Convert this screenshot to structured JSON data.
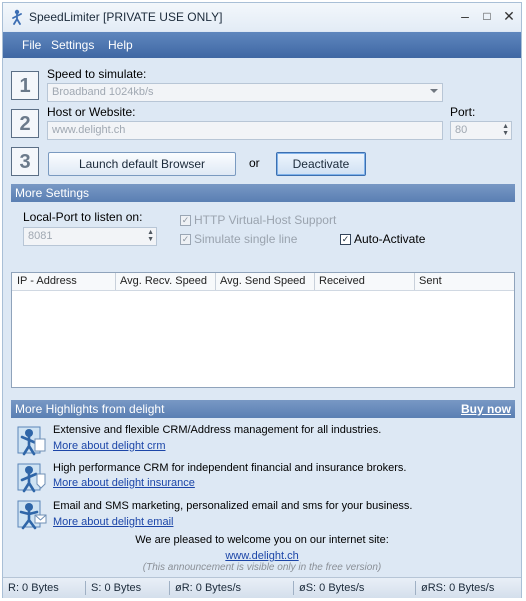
{
  "window": {
    "title": "SpeedLimiter [PRIVATE USE ONLY]",
    "controls": [
      "–",
      "□",
      "✕"
    ]
  },
  "menu": [
    "File",
    "Settings",
    "Help"
  ],
  "step1": {
    "number": "1",
    "label": "Speed to simulate:",
    "value": "Broadband 1024kb/s"
  },
  "step2": {
    "number": "2",
    "label": "Host or Website:",
    "value": "www.delight.ch",
    "port_label": "Port:",
    "port_value": "80"
  },
  "step3": {
    "number": "3",
    "launch_label": "Launch default Browser",
    "or_label": "or",
    "deactivate_label": "Deactivate"
  },
  "more_settings": {
    "header": "More Settings",
    "local_port_label": "Local-Port to listen on:",
    "local_port_value": "8081",
    "http_vhost_label": "HTTP Virtual-Host Support",
    "simulate_single_line_label": "Simulate single line",
    "auto_activate_label": "Auto-Activate",
    "http_vhost_checked": true,
    "simulate_single_line_checked": true,
    "auto_activate_checked": true
  },
  "connections_table": {
    "columns": [
      "IP - Address",
      "Avg. Recv. Speed",
      "Avg. Send Speed",
      "Received",
      "Sent"
    ],
    "rows": []
  },
  "highlights": {
    "header": "More Highlights from delight",
    "buy_now": "Buy now",
    "items": [
      {
        "text": "Extensive and flexible CRM/Address management for all industries.",
        "link": "More about delight crm"
      },
      {
        "text": "High performance CRM for independent financial and insurance brokers.",
        "link": "More about delight insurance"
      },
      {
        "text": "Email and SMS marketing, personalized email and sms for your business.",
        "link": "More about delight email"
      }
    ],
    "welcome": "We are pleased to welcome you on our internet site:",
    "website": "www.delight.ch",
    "notice": "(This announcement is visible only in the free version)"
  },
  "status": {
    "received": "R: 0 Bytes",
    "sent": "S: 0 Bytes",
    "avg_recv": "øR: 0 Bytes/s",
    "avg_send": "øS: 0 Bytes/s",
    "avg_rs": "øRS: 0 Bytes/s"
  },
  "colors": {
    "menubar": "#4a72ad",
    "section_header": "#6a8cbc",
    "link": "#1c46a8",
    "window_bg": "#dde8f4"
  },
  "icons": {
    "app": "speedlimiter-app-icon",
    "highlight_1": "crm-person-icon",
    "highlight_2": "insurance-person-icon",
    "highlight_3": "email-person-icon"
  }
}
